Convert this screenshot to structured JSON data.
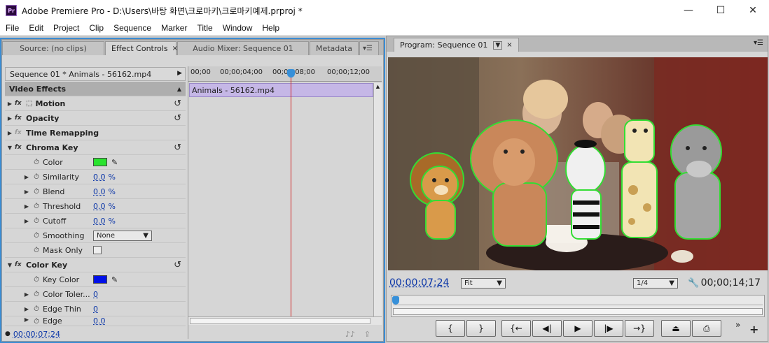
{
  "window": {
    "title": "Adobe Premiere Pro - D:\\Users\\바탕 화면\\크로마키\\크로마키예제.prproj *",
    "app_icon": "Pr",
    "minimize": "—",
    "maximize": "☐",
    "close": "✕"
  },
  "menu": [
    "File",
    "Edit",
    "Project",
    "Clip",
    "Sequence",
    "Marker",
    "Title",
    "Window",
    "Help"
  ],
  "left_panel": {
    "tabs": [
      {
        "label": "Source: (no clips)"
      },
      {
        "label": "Effect Controls",
        "active": true
      },
      {
        "label": "Audio Mixer: Sequence 01"
      },
      {
        "label": "Metadata"
      }
    ],
    "sequence_header": "Sequence 01 * Animals - 56162.mp4",
    "ruler": [
      "00;00",
      "00;00;04;00",
      "00;00;08;00",
      "00;00;12;00"
    ],
    "clip_label": "Animals - 56162.mp4",
    "sections": {
      "video_effects": "Video Effects"
    },
    "effects": {
      "motion": "Motion",
      "opacity": "Opacity",
      "time_remap": "Time Remapping",
      "chroma": "Chroma Key",
      "chroma_color_label": "Color",
      "chroma_color": "#29e32e",
      "similarity_label": "Similarity",
      "similarity": "0.0",
      "similarity_unit": "%",
      "blend_label": "Blend",
      "blend": "0.0",
      "blend_unit": "%",
      "threshold_label": "Threshold",
      "threshold": "0.0",
      "threshold_unit": "%",
      "cutoff_label": "Cutoff",
      "cutoff": "0.0",
      "cutoff_unit": "%",
      "smoothing_label": "Smoothing",
      "smoothing": "None",
      "mask_only_label": "Mask Only",
      "color_key": "Color Key",
      "key_color_label": "Key Color",
      "key_color": "#0010e8",
      "color_tol_label": "Color Toler...",
      "color_tol": "0",
      "edge_thin_label": "Edge Thin",
      "edge_thin": "0",
      "edge_feather_label": "Edge Feather",
      "edge_feather": "0.0"
    },
    "status_timecode": "00;00;07;24"
  },
  "right_panel": {
    "tab": "Program: Sequence 01",
    "timecode_current": "00;00;07;24",
    "zoom": "Fit",
    "resolution": "1/4",
    "timecode_duration": "00;00;14;17",
    "transport": [
      "{",
      "}",
      "{←",
      "◀|",
      "▶",
      "|▶",
      "→}",
      "",
      ""
    ]
  }
}
